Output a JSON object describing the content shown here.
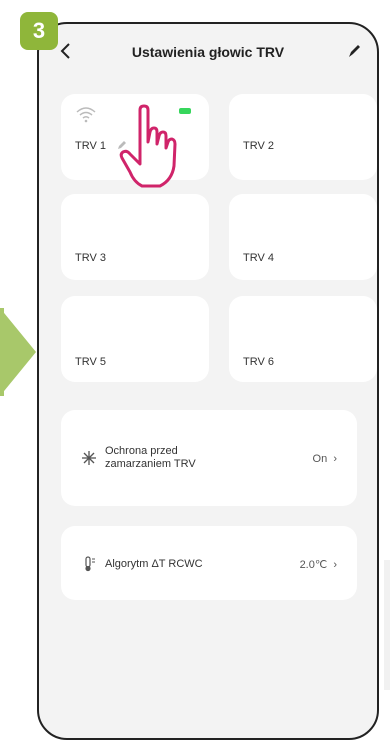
{
  "step": "3",
  "header": {
    "title": "Ustawienia głowic TRV"
  },
  "tiles": [
    {
      "label": "TRV 1"
    },
    {
      "label": "TRV 2"
    },
    {
      "label": "TRV 3"
    },
    {
      "label": "TRV 4"
    },
    {
      "label": "TRV 5"
    },
    {
      "label": "TRV 6"
    }
  ],
  "settings": [
    {
      "icon": "snowflake-icon",
      "label_line1": "Ochrona przed",
      "label_line2": "zamarzaniem TRV",
      "value": "On"
    },
    {
      "icon": "thermometer-icon",
      "label": "Algorytm ΔT RCWC",
      "value": "2.0℃"
    }
  ],
  "colors": {
    "accent": "#8fb63a",
    "battery": "#37d65c",
    "hand": "#d0246a"
  }
}
